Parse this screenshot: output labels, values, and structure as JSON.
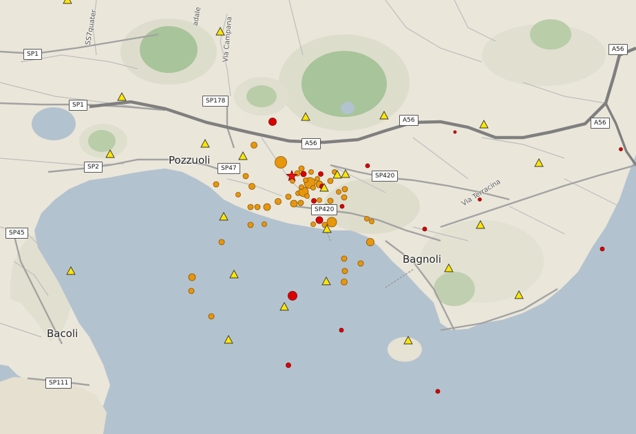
{
  "map": {
    "colors": {
      "sea": "#b3c2cf",
      "land": "#eae6da",
      "crater": "#a8c49a",
      "road": "#9a9a9a",
      "motorway": "#8c8c8c",
      "quake_orange": "#e8960c",
      "quake_red": "#dd0000",
      "station_yellow": "#ffe600",
      "epicenter_star": "#ee1111"
    },
    "places": {
      "pozzuoli": "Pozzuoli",
      "bagnoli": "Bagnoli",
      "bacoli": "Bacoli"
    },
    "roads": {
      "sp1_a": "SP1",
      "sp1_b": "SP1",
      "sp178": "SP178",
      "a56_a": "A56",
      "a56_b": "A56",
      "a56_c": "A56",
      "a56_d": "A56",
      "sp2": "SP2",
      "sp47": "SP47",
      "sp420_a": "SP420",
      "sp420_b": "SP420",
      "sp45": "SP45",
      "sp111": "SP111"
    },
    "streets": {
      "ss7": "SS7quater",
      "campana": "Via Campana",
      "terracina": "Via Terracina",
      "adale": "adale"
    },
    "legend_icons": {
      "earthquake": "earthquake-dot-icon",
      "station": "seismic-station-triangle-icon",
      "epicenter": "main-epicenter-star-icon"
    }
  }
}
